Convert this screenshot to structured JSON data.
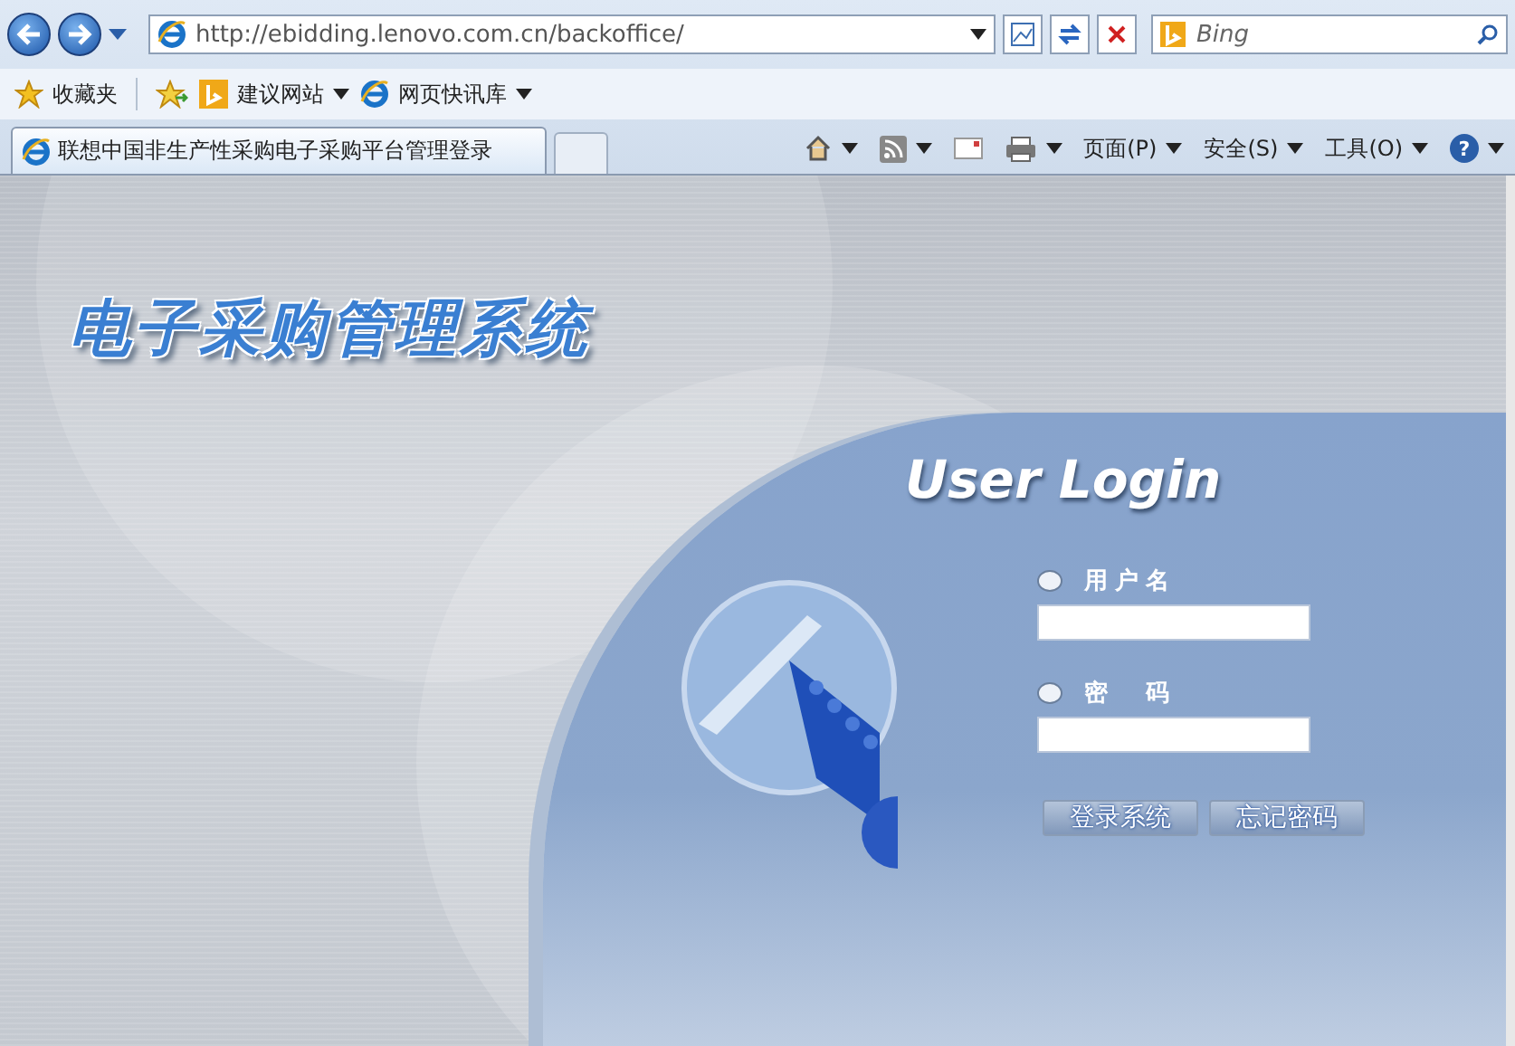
{
  "browser": {
    "address": "http://ebidding.lenovo.com.cn/backoffice/",
    "search_placeholder": "Bing",
    "favorites": [
      {
        "label": "收藏夹"
      },
      {
        "label": "建议网站"
      },
      {
        "label": "网页快讯库"
      }
    ],
    "tab": {
      "title": "联想中国非生产性采购电子采购平台管理登录"
    },
    "commands": [
      "页面(P)",
      "安全(S)",
      "工具(O)"
    ],
    "help": "?"
  },
  "page": {
    "title": "电子采购管理系统",
    "login_heading": "User Login",
    "fields": [
      {
        "label": "用户名"
      },
      {
        "label": "密　码"
      }
    ],
    "buttons": [
      "登录系统",
      "忘记密码"
    ]
  }
}
